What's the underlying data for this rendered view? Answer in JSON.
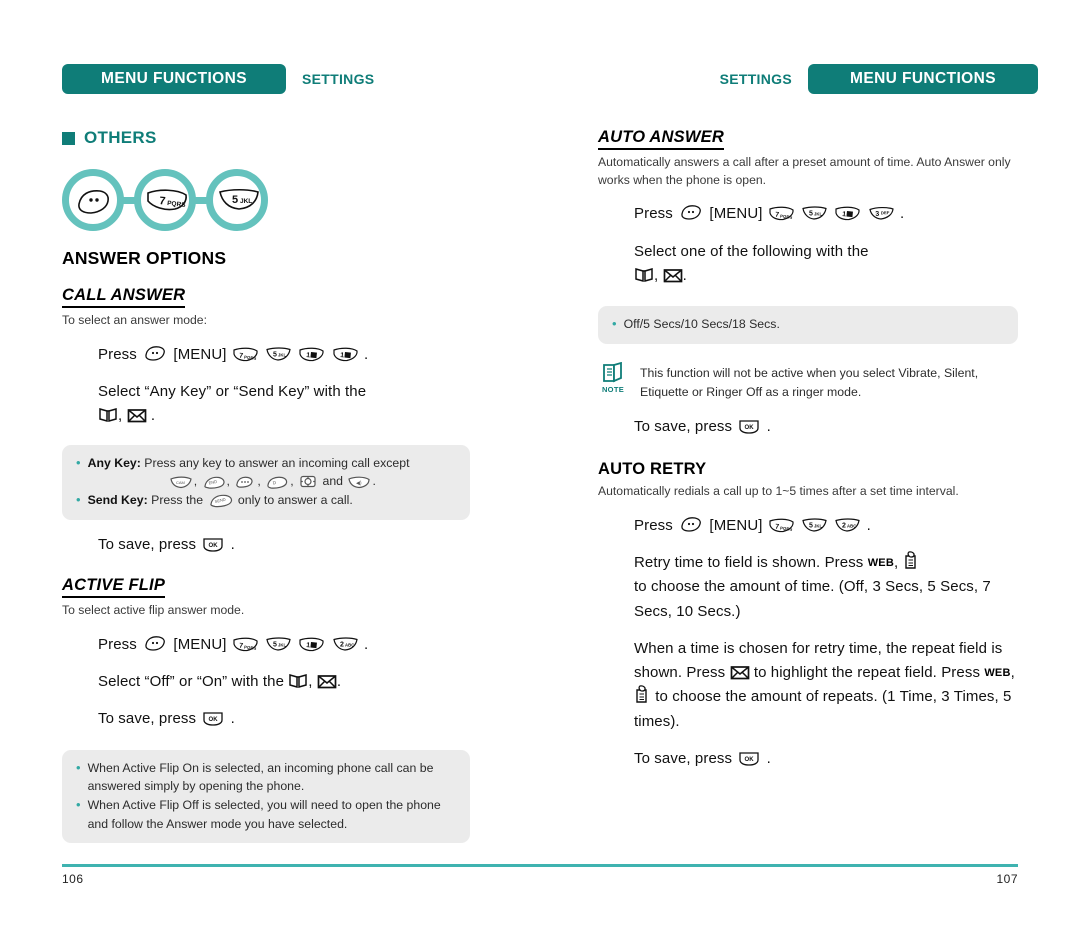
{
  "document": {
    "left_page": {
      "header": {
        "band_label": "MENU FUNCTIONS",
        "chapter_label": "SETTINGS"
      },
      "section_marker": "OTHERS",
      "keychain_keys": [
        "menu-key",
        "7PQRS",
        "5JKL"
      ],
      "group_title": "ANSWER OPTIONS",
      "sections": [
        {
          "title": "CALL ANSWER",
          "intro": "To select an answer mode:",
          "steps": [
            {
              "prefix": "Press",
              "keys": [
                "menu",
                "[MENU]",
                "7",
                "5",
                "1",
                "1"
              ],
              "suffix": "."
            },
            {
              "text": "Select “Any Key” or “Send Key” with the",
              "glyph_line": "book, envelope ."
            },
            {
              "text": "To save, press",
              "key": "ok",
              "suffix": "."
            }
          ],
          "tips": [
            {
              "label": "Any Key:",
              "text": "Press any key to answer an incoming call except",
              "icons_line": "camera , end , menu , display , navigation and volume ."
            },
            {
              "label": "Send Key:",
              "text": "Press the",
              "text_after": "only to answer a call."
            }
          ]
        },
        {
          "title": "ACTIVE FLIP",
          "intro": "To select active flip answer mode.",
          "steps": [
            {
              "prefix": "Press",
              "keys": [
                "menu",
                "[MENU]",
                "7",
                "5",
                "1",
                "2"
              ],
              "suffix": "."
            },
            {
              "text": "Select “Off” or “On” with the",
              "glyph_line": "book , envelope ."
            },
            {
              "text": "To save, press",
              "key": "ok",
              "suffix": "."
            }
          ],
          "tips": [
            {
              "text": "When Active Flip On is selected, an incoming phone call can be answered simply by opening the phone."
            },
            {
              "text": "When Active Flip Off is selected, you will need to open the phone and follow the Answer mode you have selected."
            }
          ]
        }
      ],
      "page_number": "106"
    },
    "right_page": {
      "header": {
        "band_label": "MENU FUNCTIONS",
        "chapter_label": "SETTINGS"
      },
      "sections": [
        {
          "title": "AUTO ANSWER",
          "intro": "Automatically answers a call after a preset amount of time. Auto Answer only works when the phone is open.",
          "steps": [
            {
              "prefix": "Press",
              "keys": [
                "menu",
                "[MENU]",
                "7",
                "5",
                "1",
                "3"
              ],
              "suffix": "."
            },
            {
              "text": "Select one of the following with the",
              "glyph_line": "book , envelope ."
            },
            {
              "text": "To save, press",
              "key": "ok",
              "suffix": "."
            }
          ],
          "tips": [
            {
              "text": "Off/5 Secs/10 Secs/18 Secs."
            }
          ],
          "note": "This function will not be active when you select Vibrate, Silent, Etiquette or Ringer Off as a ringer mode."
        },
        {
          "title": "AUTO RETRY",
          "intro": "Automatically redials a call up to 1~5 times after a set time interval.",
          "steps": [
            {
              "prefix": "Press",
              "keys": [
                "menu",
                "[MENU]",
                "7",
                "5",
                "2"
              ],
              "suffix": "."
            },
            {
              "text_a": "Retry time to field is shown. Press",
              "text_b": "to choose the amount of time. (Off, 3 Secs, 5 Secs, 7 Secs, 10 Secs.)"
            },
            {
              "text_a": "When a time is chosen for retry time, the repeat field is shown. Press",
              "text_b": "to highlight the repeat field. Press",
              "text_c": "to choose the amount of repeats.  (1 Time, 3 Times, 5 times)."
            },
            {
              "text": "To save, press",
              "key": "ok",
              "suffix": "."
            }
          ]
        }
      ],
      "page_number": "107"
    }
  },
  "keys": {
    "menu_label": "MENU",
    "ok_label": "OK",
    "web_label": "WEB",
    "k1": {
      "digit": "1",
      "letters": ""
    },
    "k2": {
      "digit": "2",
      "letters": "ABC"
    },
    "k3": {
      "digit": "3",
      "letters": "DEF"
    },
    "k5": {
      "digit": "5",
      "letters": "JKL"
    },
    "k7": {
      "digit": "7",
      "letters": "PQRS"
    }
  },
  "note_label": "NOTE",
  "colors": {
    "teal": "#0f7d78",
    "teal_light": "#64c2bd",
    "rule": "#3fb3b0",
    "tipbox": "#ebebeb"
  }
}
